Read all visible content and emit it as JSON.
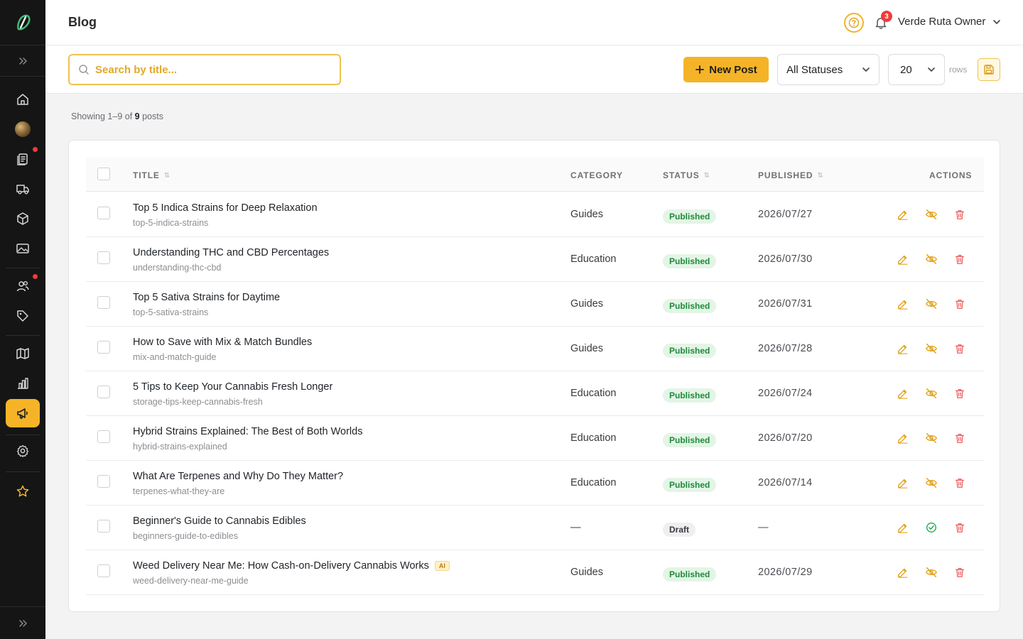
{
  "sidebar": {
    "items": [
      {
        "name": "home-icon",
        "dot": false,
        "active": false
      },
      {
        "name": "profile-avatar",
        "dot": false,
        "active": false
      },
      {
        "name": "orders-icon",
        "dot": true,
        "active": false
      },
      {
        "name": "delivery-truck-icon",
        "dot": false,
        "active": false
      },
      {
        "name": "products-box-icon",
        "dot": false,
        "active": false
      },
      {
        "name": "media-image-icon",
        "dot": false,
        "active": false
      },
      {
        "name": "customers-users-icon",
        "dot": true,
        "active": false
      },
      {
        "name": "tags-icon",
        "dot": false,
        "active": false
      },
      {
        "name": "map-icon",
        "dot": false,
        "active": false
      },
      {
        "name": "analytics-chart-icon",
        "dot": false,
        "active": false
      },
      {
        "name": "marketing-megaphone-icon",
        "dot": false,
        "active": true
      },
      {
        "name": "settings-gear-icon",
        "dot": false,
        "active": false
      },
      {
        "name": "favorites-star-icon",
        "dot": false,
        "active": false
      }
    ]
  },
  "header": {
    "title": "Blog",
    "notification_count": "3",
    "user_name": "Verde Ruta Owner"
  },
  "toolbar": {
    "search_placeholder": "Search by title...",
    "new_post_label": "New Post",
    "status_filter": "All Statuses",
    "rows_value": "20",
    "rows_label": "rows"
  },
  "summary": {
    "prefix": "Showing 1–9 of",
    "total": "9",
    "suffix": "posts"
  },
  "table": {
    "columns": {
      "title": "TITLE",
      "category": "CATEGORY",
      "status": "STATUS",
      "published": "PUBLISHED",
      "actions": "ACTIONS"
    },
    "rows": [
      {
        "title": "Top 5 Indica Strains for Deep Relaxation",
        "slug": "top-5-indica-strains",
        "category": "Guides",
        "status": "Published",
        "published": "2026/07/27",
        "ai": ""
      },
      {
        "title": "Understanding THC and CBD Percentages",
        "slug": "understanding-thc-cbd",
        "category": "Education",
        "status": "Published",
        "published": "2026/07/30",
        "ai": ""
      },
      {
        "title": "Top 5 Sativa Strains for Daytime",
        "slug": "top-5-sativa-strains",
        "category": "Guides",
        "status": "Published",
        "published": "2026/07/31",
        "ai": ""
      },
      {
        "title": "How to Save with Mix & Match Bundles",
        "slug": "mix-and-match-guide",
        "category": "Guides",
        "status": "Published",
        "published": "2026/07/28",
        "ai": ""
      },
      {
        "title": "5 Tips to Keep Your Cannabis Fresh Longer",
        "slug": "storage-tips-keep-cannabis-fresh",
        "category": "Education",
        "status": "Published",
        "published": "2026/07/24",
        "ai": ""
      },
      {
        "title": "Hybrid Strains Explained: The Best of Both Worlds",
        "slug": "hybrid-strains-explained",
        "category": "Education",
        "status": "Published",
        "published": "2026/07/20",
        "ai": ""
      },
      {
        "title": "What Are Terpenes and Why Do They Matter?",
        "slug": "terpenes-what-they-are",
        "category": "Education",
        "status": "Published",
        "published": "2026/07/14",
        "ai": ""
      },
      {
        "title": "Beginner's Guide to Cannabis Edibles",
        "slug": "beginners-guide-to-edibles",
        "category": "—",
        "status": "Draft",
        "published": "—",
        "ai": ""
      },
      {
        "title": "Weed Delivery Near Me: How Cash-on-Delivery Cannabis Works",
        "slug": "weed-delivery-near-me-guide",
        "category": "Guides",
        "status": "Published",
        "published": "2026/07/29",
        "ai": "AI"
      }
    ]
  },
  "colors": {
    "accent": "#f5b427",
    "sidebar_bg": "#151515",
    "published_bg": "#e3f5e6",
    "published_text": "#1f8a3b",
    "edit_icon": "#e2a21a",
    "unpublish_icon": "#e2a21a",
    "publish_icon": "#22a54a",
    "delete_icon": "#ee5a5a",
    "notification": "#ef3b3b"
  }
}
